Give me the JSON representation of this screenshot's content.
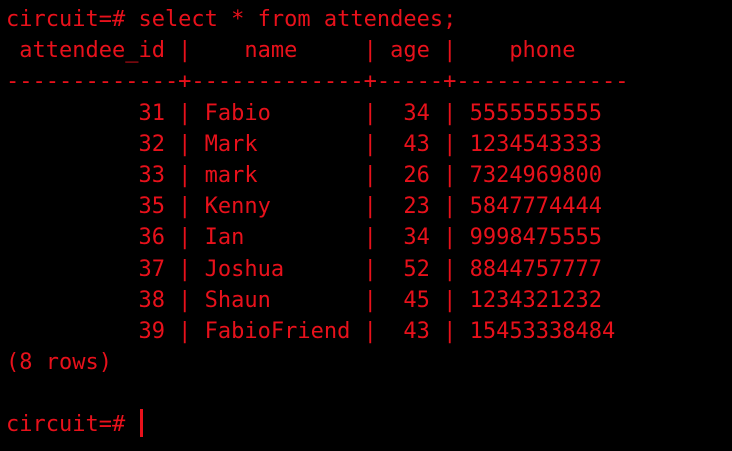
{
  "terminal": {
    "text_color": "#e8111b",
    "background_color": "#000000",
    "command_line": "circuit=# select * from attendees;",
    "header_line": " attendee_id |    name     | age |    phone",
    "separator_line": "-------------+-------------+-----+-------------",
    "columns": [
      "attendee_id",
      "name",
      "age",
      "phone"
    ],
    "rows": [
      {
        "attendee_id": "31",
        "name": "Fabio",
        "age": "34",
        "phone": "5555555555",
        "line": "          31 | Fabio       |  34 | 5555555555"
      },
      {
        "attendee_id": "32",
        "name": "Mark",
        "age": "43",
        "phone": "1234543333",
        "line": "          32 | Mark        |  43 | 1234543333"
      },
      {
        "attendee_id": "33",
        "name": "mark",
        "age": "26",
        "phone": "7324969800",
        "line": "          33 | mark        |  26 | 7324969800"
      },
      {
        "attendee_id": "35",
        "name": "Kenny",
        "age": "23",
        "phone": "5847774444",
        "line": "          35 | Kenny       |  23 | 5847774444"
      },
      {
        "attendee_id": "36",
        "name": "Ian",
        "age": "34",
        "phone": "9998475555",
        "line": "          36 | Ian         |  34 | 9998475555"
      },
      {
        "attendee_id": "37",
        "name": "Joshua",
        "age": "52",
        "phone": "8844757777",
        "line": "          37 | Joshua      |  52 | 8844757777"
      },
      {
        "attendee_id": "38",
        "name": "Shaun",
        "age": "45",
        "phone": "1234321232",
        "line": "          38 | Shaun       |  45 | 1234321232"
      },
      {
        "attendee_id": "39",
        "name": "FabioFriend",
        "age": "43",
        "phone": "15453338484",
        "line": "          39 | FabioFriend |  43 | 15453338484"
      }
    ],
    "row_count_text": "(8 rows)",
    "prompt": "circuit=# "
  }
}
